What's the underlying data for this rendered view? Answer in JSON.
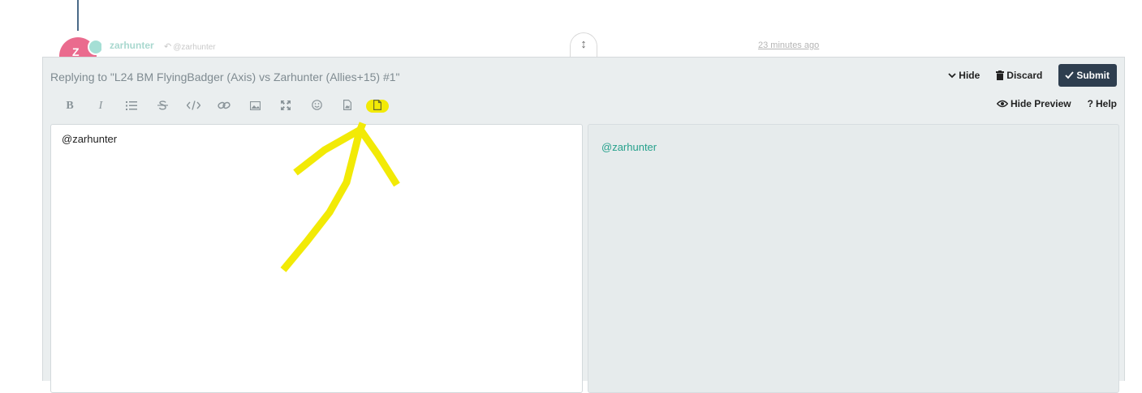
{
  "post": {
    "avatar_letter": "Z",
    "username": "zarhunter",
    "reply_to": "@zarhunter",
    "timestamp": "23 minutes ago"
  },
  "composer": {
    "reply_title": "Replying to \"L24 BM FlyingBadger (Axis) vs Zarhunter (Allies+15) #1\"",
    "hide_label": "Hide",
    "discard_label": "Discard",
    "submit_label": "Submit",
    "toolbar": {
      "bold": "B",
      "italic": "I"
    },
    "hide_preview_label": "Hide Preview",
    "help_label": "Help",
    "editor_value": "@zarhunter",
    "preview_text": "@zarhunter"
  },
  "colors": {
    "submit_bg": "#2e3e4f",
    "mention": "#26a18c",
    "annotation": "#f2ea06",
    "avatar": "#ea6b8e"
  },
  "icons": [
    "reply-arrow-icon",
    "expand-icon",
    "chevron-down-icon",
    "trash-icon",
    "check-icon",
    "list-icon",
    "strikethrough-icon",
    "code-icon",
    "link-icon",
    "image-icon",
    "fullscreen-icon",
    "emoji-icon",
    "file-icon",
    "document-icon",
    "eye-icon",
    "question-icon"
  ]
}
